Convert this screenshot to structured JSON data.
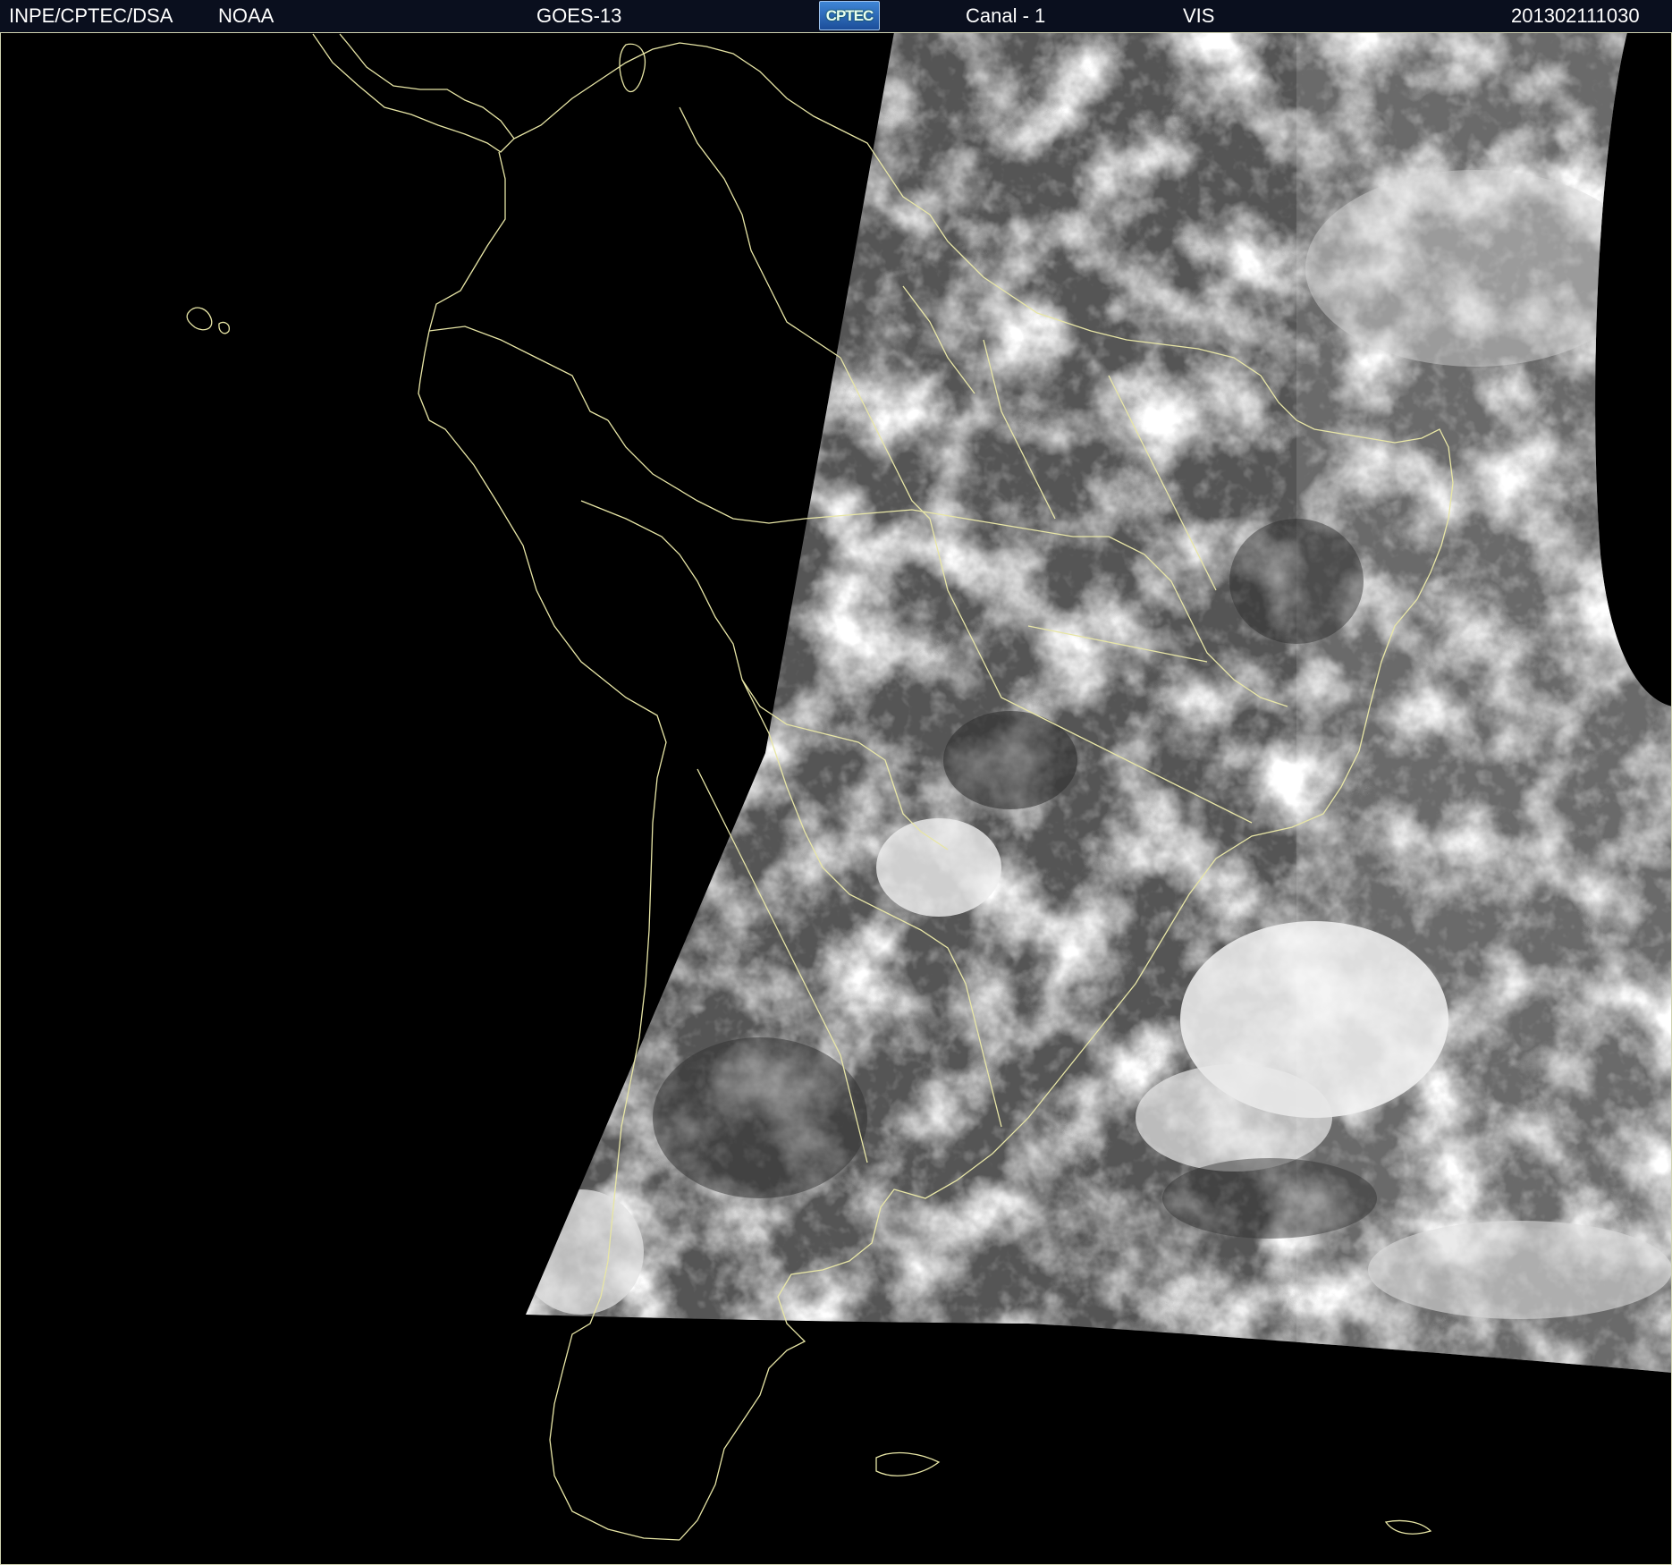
{
  "header": {
    "agency": "INPE/CPTEC/DSA",
    "provider": "NOAA",
    "satellite": "GOES-13",
    "logo_text": "CPTEC",
    "channel": "Canal - 1",
    "band": "VIS",
    "timestamp": "201302111030"
  },
  "colors": {
    "background": "#000000",
    "coastline": "#e8e6a6",
    "header_bg": "#0a0f1e",
    "header_text": "#ffffff",
    "logo": "#2a6ac0"
  },
  "icons": {
    "logo": "cptec-logo-icon"
  }
}
